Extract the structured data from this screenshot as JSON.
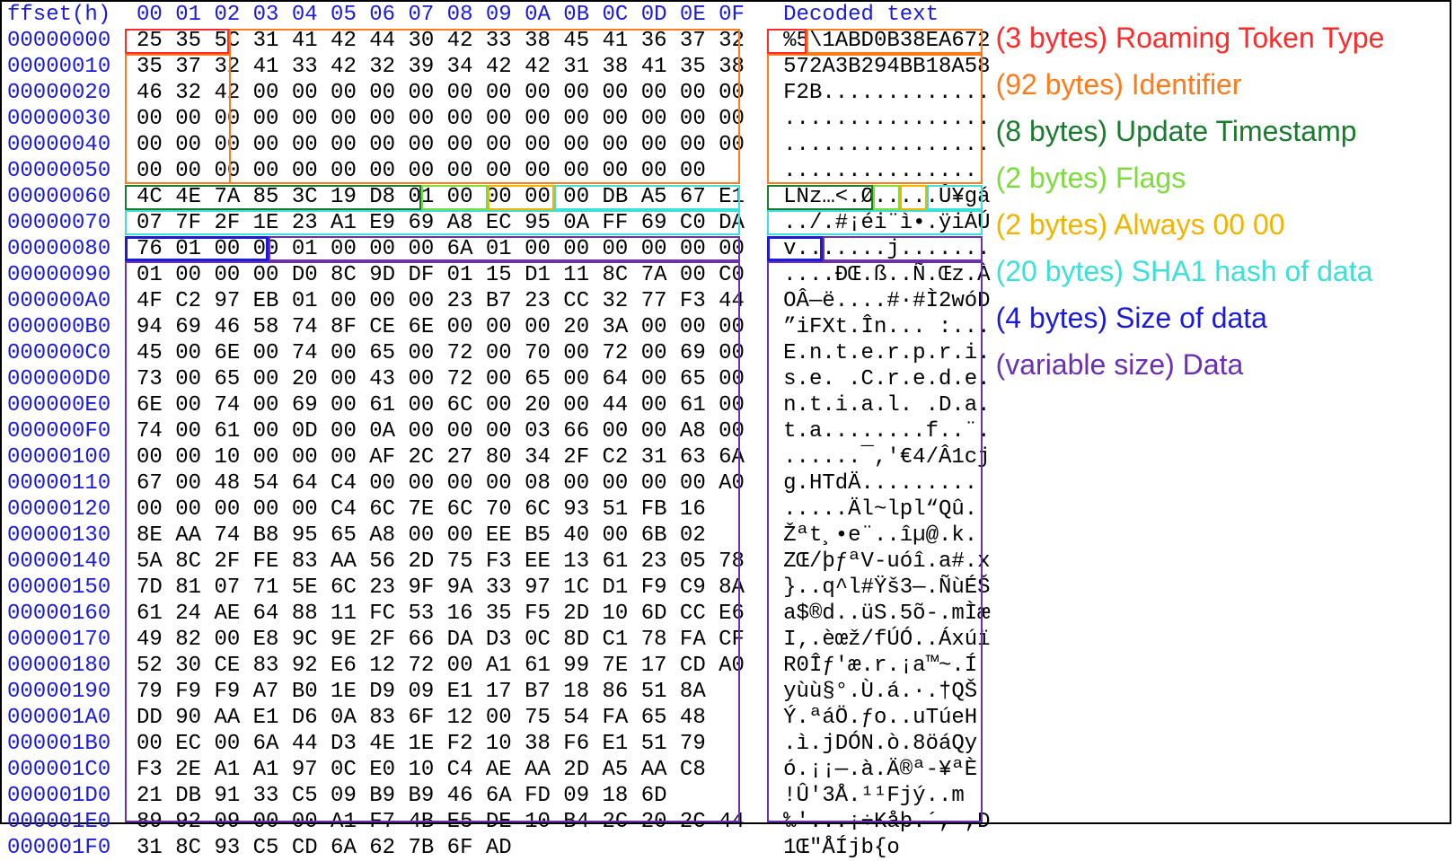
{
  "columns_header": "ffset(h)  00 01 02 03 04 05 06 07 08 09 0A 0B 0C 0D 0E 0F   Decoded text",
  "rows": [
    {
      "o": "00000000",
      "h": "25 35 5C 31 41 42 44 30 42 33 38 45 41 36 37 32",
      "a": "%5\\1ABD0B38EA672"
    },
    {
      "o": "00000010",
      "h": "35 37 32 41 33 42 32 39 34 42 42 31 38 41 35 38",
      "a": "572A3B294BB18A58"
    },
    {
      "o": "00000020",
      "h": "46 32 42 00 00 00 00 00 00 00 00 00 00 00 00 00",
      "a": "F2B............."
    },
    {
      "o": "00000030",
      "h": "00 00 00 00 00 00 00 00 00 00 00 00 00 00 00 00",
      "a": "................"
    },
    {
      "o": "00000040",
      "h": "00 00 00 00 00 00 00 00 00 00 00 00 00 00 00 00",
      "a": "................"
    },
    {
      "o": "00000050",
      "h": "00 00 00 00 00 00 00 00 00 00 00 00 00 00 00   ",
      "a": "..............."
    },
    {
      "o": "00000060",
      "h": "4C 4E 7A 85 3C 19 D8 01 00 00 00 00 DB A5 67 E1",
      "a": "LNz…<.Ø.....Û¥gá"
    },
    {
      "o": "00000070",
      "h": "07 7F 2F 1E 23 A1 E9 69 A8 EC 95 0A FF 69 C0 DA",
      "a": "../.#¡éi¨ì•.ÿiÀÚ"
    },
    {
      "o": "00000080",
      "h": "76 01 00 00 01 00 00 00 6A 01 00 00 00 00 00 00",
      "a": "v.......j......."
    },
    {
      "o": "00000090",
      "h": "01 00 00 00 D0 8C 9D DF 01 15 D1 11 8C 7A 00 C0",
      "a": "....ÐŒ.ß..Ñ.Œz.À"
    },
    {
      "o": "000000A0",
      "h": "4F C2 97 EB 01 00 00 00 23 B7 23 CC 32 77 F3 44",
      "a": "OÂ—ë....#·#Ì2wóD"
    },
    {
      "o": "000000B0",
      "h": "94 69 46 58 74 8F CE 6E 00 00 00 20 3A 00 00 00",
      "a": "”iFXt.În... :..."
    },
    {
      "o": "000000C0",
      "h": "45 00 6E 00 74 00 65 00 72 00 70 00 72 00 69 00",
      "a": "E.n.t.e.r.p.r.i."
    },
    {
      "o": "000000D0",
      "h": "73 00 65 00 20 00 43 00 72 00 65 00 64 00 65 00",
      "a": "s.e. .C.r.e.d.e."
    },
    {
      "o": "000000E0",
      "h": "6E 00 74 00 69 00 61 00 6C 00 20 00 44 00 61 00",
      "a": "n.t.i.a.l. .D.a."
    },
    {
      "o": "000000F0",
      "h": "74 00 61 00 0D 00 0A 00 00 00 03 66 00 00 A8 00",
      "a": "t.a........f..¨."
    },
    {
      "o": "00000100",
      "h": "00 00 10 00 00 00 AF 2C 27 80 34 2F C2 31 63 6A",
      "a": "......¯,'€4/Â1cj"
    },
    {
      "o": "00000110",
      "h": "67 00 48 54 64 C4 00 00 00 00 08 00 00 00 00 A0",
      "a": "g.HTdÄ......... "
    },
    {
      "o": "00000120",
      "h": "00 00 00 00 00 C4 6C 7E 6C 70 6C 93 51 FB 16   ",
      "a": ".....Äl~lpl“Qû."
    },
    {
      "o": "00000130",
      "h": "8E AA 74 B8 95 65 A8 00 00 EE B5 40 00 6B 02   ",
      "a": "Žªt¸•e¨..îµ@.k."
    },
    {
      "o": "00000140",
      "h": "5A 8C 2F FE 83 AA 56 2D 75 F3 EE 13 61 23 05 78",
      "a": "ZŒ/þƒªV-uóî.a#.x"
    },
    {
      "o": "00000150",
      "h": "7D 81 07 71 5E 6C 23 9F 9A 33 97 1C D1 F9 C9 8A",
      "a": "}..q^l#Ÿš3—.ÑùÉŠ"
    },
    {
      "o": "00000160",
      "h": "61 24 AE 64 88 11 FC 53 16 35 F5 2D 10 6D CC E6",
      "a": "a$®d..üS.5õ-.mÌæ"
    },
    {
      "o": "00000170",
      "h": "49 82 00 E8 9C 9E 2F 66 DA D3 0C 8D C1 78 FA CF",
      "a": "I‚.èœž/fÚÓ..Áxúï"
    },
    {
      "o": "00000180",
      "h": "52 30 CE 83 92 E6 12 72 00 A1 61 99 7E 17 CD A0",
      "a": "R0Îƒ'æ.r.¡a™~.Í "
    },
    {
      "o": "00000190",
      "h": "79 F9 F9 A7 B0 1E D9 09 E1 17 B7 18 86 51 8A   ",
      "a": "yùù§°.Ù.á.·.†QŠ"
    },
    {
      "o": "000001A0",
      "h": "DD 90 AA E1 D6 0A 83 6F 12 00 75 54 FA 65 48   ",
      "a": "Ý.ªáÖ.ƒo..uTúeH"
    },
    {
      "o": "000001B0",
      "h": "00 EC 00 6A 44 D3 4E 1E F2 10 38 F6 E1 51 79   ",
      "a": ".ì.jDÓN.ò.8öáQy"
    },
    {
      "o": "000001C0",
      "h": "F3 2E A1 A1 97 0C E0 10 C4 AE AA 2D A5 AA C8   ",
      "a": "ó.¡¡—.à.Ä®ª-¥ªÈ"
    },
    {
      "o": "000001D0",
      "h": "21 DB 91 33 C5 09 B9 B9 46 6A FD 09 18 6D      ",
      "a": "!Û'3Å.¹¹Fjý..m"
    },
    {
      "o": "000001E0",
      "h": "89 92 09 00 00 A1 F7 4B E5 DE 10 B4 2C 20 2C 44",
      "a": "‰'...¡÷Kåþ.´, ,D"
    },
    {
      "o": "000001F0",
      "h": "31 8C 93 C5 CD 6A 62 7B 6F AD                  ",
      "a": "1Œ\"ÅÍjb{o­"
    }
  ],
  "legend": {
    "token_type": {
      "bytes": "(3 bytes)",
      "label": "Roaming Token Type",
      "color": "#ff2a2a"
    },
    "identifier": {
      "bytes": "(92 bytes)",
      "label": "Identifier",
      "color": "#ff7a1a"
    },
    "timestamp": {
      "bytes": "(8 bytes)",
      "label": "Update Timestamp",
      "color": "#1a7a2e"
    },
    "flags": {
      "bytes": "(2 bytes)",
      "label": "Flags",
      "color": "#7ddc3c"
    },
    "always00": {
      "bytes": "(2 bytes)",
      "label": "Always 00 00",
      "color": "#f0b400"
    },
    "sha1": {
      "bytes": "(20 bytes)",
      "label": "SHA1 hash of data",
      "color": "#3de0d8"
    },
    "sizeofdata": {
      "bytes": "(4 bytes)",
      "label": "Size of data",
      "color": "#1a1ad8"
    },
    "data": {
      "bytes": "(variable size)",
      "label": "Data",
      "color": "#6a2fb5"
    }
  }
}
